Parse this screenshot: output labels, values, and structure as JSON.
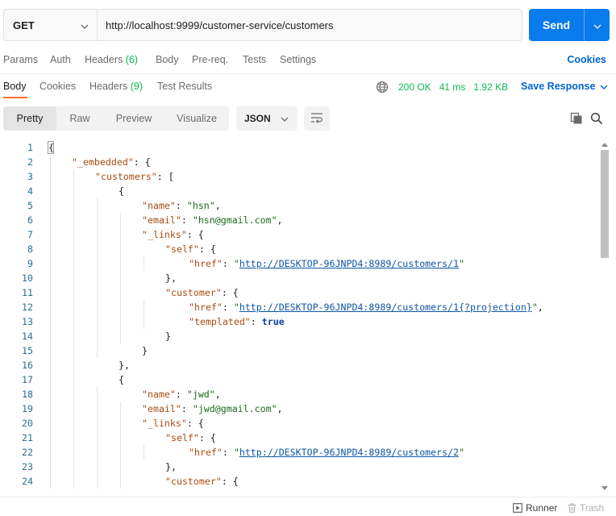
{
  "request": {
    "method": "GET",
    "url": "http://localhost:9999/customer-service/customers",
    "send_label": "Send"
  },
  "request_tabs": [
    {
      "label": "Params"
    },
    {
      "label": "Auth"
    },
    {
      "label": "Headers",
      "count": "(6)"
    },
    {
      "label": "Body"
    },
    {
      "label": "Pre-req."
    },
    {
      "label": "Tests"
    },
    {
      "label": "Settings"
    }
  ],
  "cookies_label": "Cookies",
  "response_tabs": [
    {
      "label": "Body"
    },
    {
      "label": "Cookies"
    },
    {
      "label": "Headers",
      "count": "(9)"
    },
    {
      "label": "Test Results"
    }
  ],
  "status": {
    "code": "200 OK",
    "time": "41 ms",
    "size": "1.92 KB",
    "save_label": "Save Response"
  },
  "view_modes": [
    "Pretty",
    "Raw",
    "Preview",
    "Visualize"
  ],
  "active_view": "Pretty",
  "format": "JSON",
  "code_lines": [
    [
      {
        "t": "p",
        "v": "{"
      }
    ],
    [
      {
        "t": "k",
        "v": "\"_embedded\""
      },
      {
        "t": "p",
        "v": ": {"
      }
    ],
    [
      {
        "t": "k",
        "v": "\"customers\""
      },
      {
        "t": "p",
        "v": ": ["
      }
    ],
    [
      {
        "t": "p",
        "v": "{"
      }
    ],
    [
      {
        "t": "k",
        "v": "\"name\""
      },
      {
        "t": "p",
        "v": ": "
      },
      {
        "t": "s",
        "v": "\"hsn\""
      },
      {
        "t": "p",
        "v": ","
      }
    ],
    [
      {
        "t": "k",
        "v": "\"email\""
      },
      {
        "t": "p",
        "v": ": "
      },
      {
        "t": "s",
        "v": "\"hsn@gmail.com\""
      },
      {
        "t": "p",
        "v": ","
      }
    ],
    [
      {
        "t": "k",
        "v": "\"_links\""
      },
      {
        "t": "p",
        "v": ": {"
      }
    ],
    [
      {
        "t": "k",
        "v": "\"self\""
      },
      {
        "t": "p",
        "v": ": {"
      }
    ],
    [
      {
        "t": "k",
        "v": "\"href\""
      },
      {
        "t": "p",
        "v": ": "
      },
      {
        "t": "s",
        "v": "\""
      },
      {
        "t": "u",
        "v": "http://DESKTOP-96JNPD4:8989/customers/1"
      },
      {
        "t": "s",
        "v": "\""
      }
    ],
    [
      {
        "t": "p",
        "v": "},"
      }
    ],
    [
      {
        "t": "k",
        "v": "\"customer\""
      },
      {
        "t": "p",
        "v": ": {"
      }
    ],
    [
      {
        "t": "k",
        "v": "\"href\""
      },
      {
        "t": "p",
        "v": ": "
      },
      {
        "t": "s",
        "v": "\""
      },
      {
        "t": "u",
        "v": "http://DESKTOP-96JNPD4:8989/customers/1{?projection}"
      },
      {
        "t": "s",
        "v": "\""
      },
      {
        "t": "p",
        "v": ","
      }
    ],
    [
      {
        "t": "k",
        "v": "\"templated\""
      },
      {
        "t": "p",
        "v": ": "
      },
      {
        "t": "b",
        "v": "true"
      }
    ],
    [
      {
        "t": "p",
        "v": "}"
      }
    ],
    [
      {
        "t": "p",
        "v": "}"
      }
    ],
    [
      {
        "t": "p",
        "v": "},"
      }
    ],
    [
      {
        "t": "p",
        "v": "{"
      }
    ],
    [
      {
        "t": "k",
        "v": "\"name\""
      },
      {
        "t": "p",
        "v": ": "
      },
      {
        "t": "s",
        "v": "\"jwd\""
      },
      {
        "t": "p",
        "v": ","
      }
    ],
    [
      {
        "t": "k",
        "v": "\"email\""
      },
      {
        "t": "p",
        "v": ": "
      },
      {
        "t": "s",
        "v": "\"jwd@gmail.com\""
      },
      {
        "t": "p",
        "v": ","
      }
    ],
    [
      {
        "t": "k",
        "v": "\"_links\""
      },
      {
        "t": "p",
        "v": ": {"
      }
    ],
    [
      {
        "t": "k",
        "v": "\"self\""
      },
      {
        "t": "p",
        "v": ": {"
      }
    ],
    [
      {
        "t": "k",
        "v": "\"href\""
      },
      {
        "t": "p",
        "v": ": "
      },
      {
        "t": "s",
        "v": "\""
      },
      {
        "t": "u",
        "v": "http://DESKTOP-96JNPD4:8989/customers/2"
      },
      {
        "t": "s",
        "v": "\""
      }
    ],
    [
      {
        "t": "p",
        "v": "},"
      }
    ],
    [
      {
        "t": "k",
        "v": "\"customer\""
      },
      {
        "t": "p",
        "v": ": {"
      }
    ]
  ],
  "footer": {
    "runner_label": "Runner",
    "trash_label": "Trash"
  },
  "colors": {
    "accent": "#097bed",
    "link": "#0265d2",
    "status_ok": "#0cbb52",
    "active_tab_underline": "#ff6c37"
  }
}
